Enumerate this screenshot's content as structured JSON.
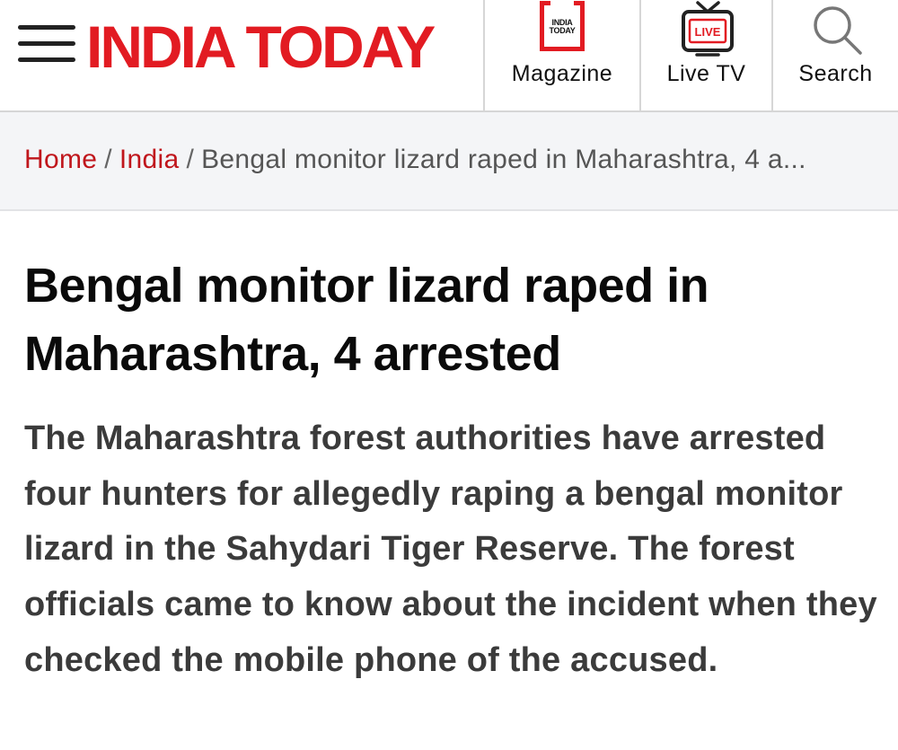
{
  "header": {
    "logo_text": "INDIA TODAY",
    "brand_color": "#e21b22",
    "nav": [
      {
        "label": "Magazine",
        "icon": "magazine-icon",
        "icon_text_line1": "INDIA",
        "icon_text_line2": "TODAY"
      },
      {
        "label": "Live TV",
        "icon": "live-tv-icon",
        "icon_text": "LIVE"
      },
      {
        "label": "Search",
        "icon": "search-icon"
      }
    ]
  },
  "breadcrumb": {
    "items": [
      {
        "label": "Home"
      },
      {
        "label": "India"
      }
    ],
    "separator": "/",
    "current": "Bengal monitor lizard raped in Maharashtra, 4 a..."
  },
  "article": {
    "headline": "Bengal monitor lizard raped in Maharashtra, 4 arrested",
    "summary": "The Maharashtra forest authorities have arrested four hunters for allegedly raping a bengal monitor lizard in the Sahydari Tiger Reserve. The forest officials came to know about the incident when they checked the mobile phone of the accused."
  },
  "colors": {
    "link_red": "#c0161c",
    "breadcrumb_bg": "#f4f5f7",
    "summary_text": "#3b3b3b"
  }
}
